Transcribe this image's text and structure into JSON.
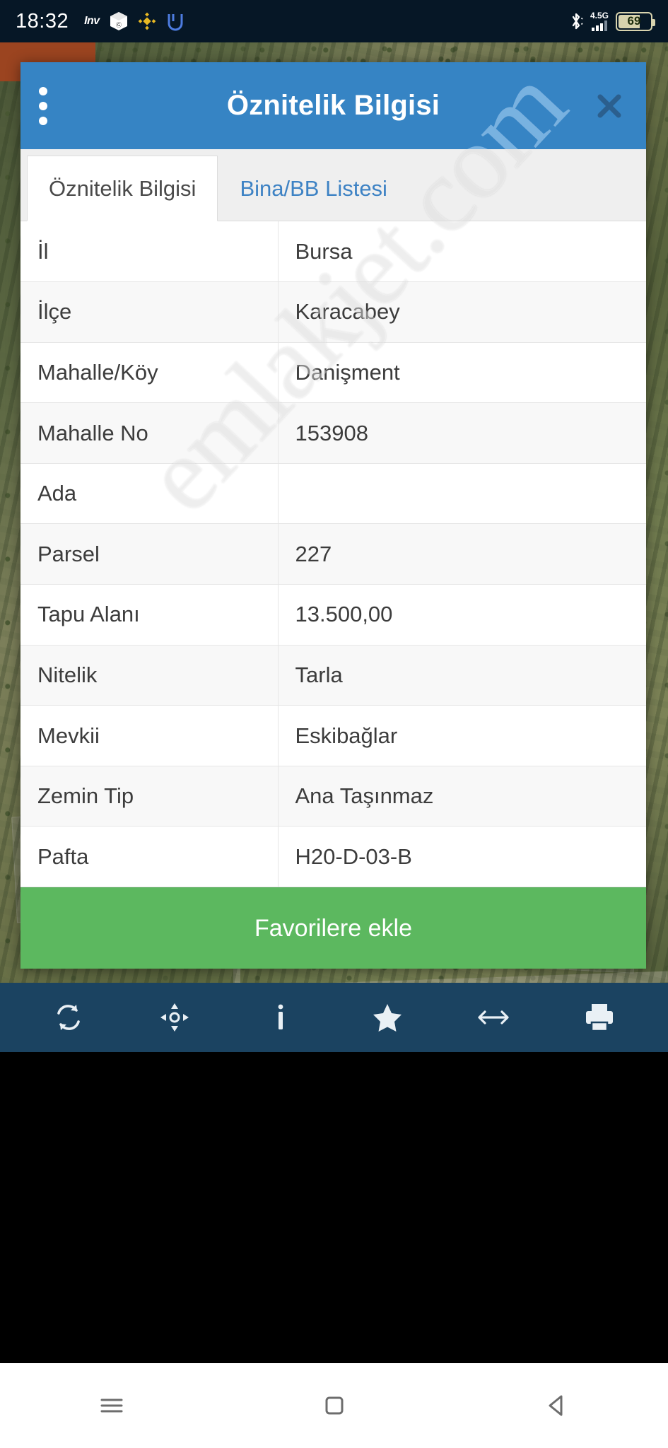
{
  "statusbar": {
    "time": "18:32",
    "left_icons": [
      {
        "name": "inv-app-icon",
        "label": "Inv"
      },
      {
        "name": "cube-app-icon",
        "label": ""
      },
      {
        "name": "binance-app-icon",
        "label": ""
      },
      {
        "name": "up-app-icon",
        "label": ""
      }
    ],
    "bluetooth_icon": "bluetooth-icon",
    "network_label": "4.5G",
    "battery_percent": "69",
    "bg_color": "#061726"
  },
  "dialog": {
    "title": "Öznitelik Bilgisi",
    "menu_icon": "kebab-menu-icon",
    "close_icon": "close-icon",
    "header_color": "#3684c4",
    "tabs": [
      {
        "label": "Öznitelik Bilgisi",
        "active": true
      },
      {
        "label": "Bina/BB Listesi",
        "active": false
      }
    ],
    "table": {
      "rows": [
        {
          "key": "İl",
          "value": "Bursa"
        },
        {
          "key": "İlçe",
          "value": "Karacabey"
        },
        {
          "key": "Mahalle/Köy",
          "value": "Danişment"
        },
        {
          "key": "Mahalle No",
          "value": "153908"
        },
        {
          "key": "Ada",
          "value": ""
        },
        {
          "key": "Parsel",
          "value": "227"
        },
        {
          "key": "Tapu Alanı",
          "value": "13.500,00"
        },
        {
          "key": "Nitelik",
          "value": "Tarla"
        },
        {
          "key": "Mevkii",
          "value": "Eskibağlar"
        },
        {
          "key": "Zemin Tip",
          "value": "Ana Taşınmaz"
        },
        {
          "key": "Pafta",
          "value": "H20-D-03-B"
        }
      ]
    },
    "favorite_button": {
      "label": "Favorilere ekle",
      "color": "#5cb85f"
    }
  },
  "watermark": {
    "text": "emlakjet.com"
  },
  "app_toolbar": {
    "bg_color": "#1b4361",
    "items": [
      {
        "name": "refresh-icon"
      },
      {
        "name": "pan-move-icon"
      },
      {
        "name": "info-icon"
      },
      {
        "name": "star-icon"
      },
      {
        "name": "measure-distance-icon"
      },
      {
        "name": "print-icon"
      }
    ]
  },
  "navbar": {
    "items": [
      {
        "name": "recent-apps-icon"
      },
      {
        "name": "home-icon"
      },
      {
        "name": "back-icon"
      }
    ]
  }
}
